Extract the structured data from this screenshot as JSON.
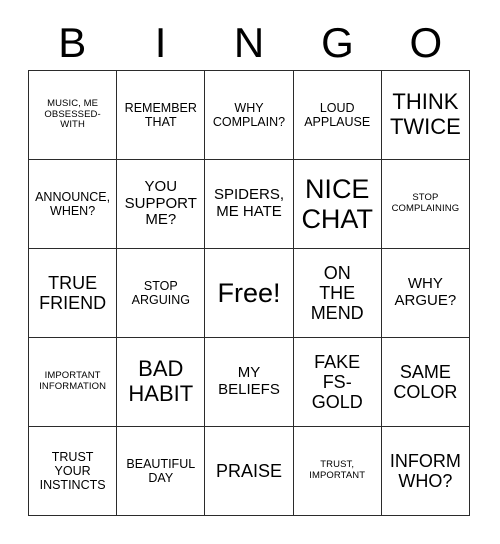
{
  "card": {
    "type": "bingo-card",
    "columns": 5,
    "rows": 5,
    "header": {
      "letters": [
        "B",
        "I",
        "N",
        "G",
        "O"
      ]
    },
    "colors": {
      "background": "#ffffff",
      "border": "#2b2b2b",
      "text": "#000000"
    },
    "cells": [
      {
        "text": "MUSIC, ME\nOBSESSED-\nWITH",
        "size": "xs",
        "column": "B",
        "row": 1
      },
      {
        "text": "REMEMBER\nTHAT",
        "size": "s",
        "column": "I",
        "row": 1
      },
      {
        "text": "WHY\nCOMPLAIN?",
        "size": "s",
        "column": "N",
        "row": 1
      },
      {
        "text": "LOUD\nAPPLAUSE",
        "size": "s",
        "column": "G",
        "row": 1
      },
      {
        "text": "THINK\nTWICE",
        "size": "xl",
        "column": "O",
        "row": 1
      },
      {
        "text": "ANNOUNCE,\nWHEN?",
        "size": "s",
        "column": "B",
        "row": 2
      },
      {
        "text": "YOU\nSUPPORT\nME?",
        "size": "m",
        "column": "I",
        "row": 2
      },
      {
        "text": "SPIDERS,\nME HATE",
        "size": "m",
        "column": "N",
        "row": 2
      },
      {
        "text": "NICE\nCHAT",
        "size": "xxl",
        "column": "G",
        "row": 2
      },
      {
        "text": "STOP\nCOMPLAINING",
        "size": "xs",
        "column": "O",
        "row": 2
      },
      {
        "text": "TRUE\nFRIEND",
        "size": "l",
        "column": "B",
        "row": 3
      },
      {
        "text": "STOP\nARGUING",
        "size": "s",
        "column": "I",
        "row": 3
      },
      {
        "text": "Free!",
        "size": "free",
        "column": "N",
        "row": 3
      },
      {
        "text": "ON\nTHE\nMEND",
        "size": "l",
        "column": "G",
        "row": 3
      },
      {
        "text": "WHY\nARGUE?",
        "size": "m",
        "column": "O",
        "row": 3
      },
      {
        "text": "IMPORTANT\nINFORMATION",
        "size": "xs",
        "column": "B",
        "row": 4
      },
      {
        "text": "BAD\nHABIT",
        "size": "xl",
        "column": "I",
        "row": 4
      },
      {
        "text": "MY\nBELIEFS",
        "size": "m",
        "column": "N",
        "row": 4
      },
      {
        "text": "FAKE\nFS-\nGOLD",
        "size": "l",
        "column": "G",
        "row": 4
      },
      {
        "text": "SAME\nCOLOR",
        "size": "l",
        "column": "O",
        "row": 4
      },
      {
        "text": "TRUST\nYOUR\nINSTINCTS",
        "size": "s",
        "column": "B",
        "row": 5
      },
      {
        "text": "BEAUTIFUL\nDAY",
        "size": "s",
        "column": "I",
        "row": 5
      },
      {
        "text": "PRAISE",
        "size": "l",
        "column": "N",
        "row": 5
      },
      {
        "text": "TRUST,\nIMPORTANT",
        "size": "xs",
        "column": "G",
        "row": 5
      },
      {
        "text": "INFORM\nWHO?",
        "size": "l",
        "column": "O",
        "row": 5
      }
    ]
  }
}
